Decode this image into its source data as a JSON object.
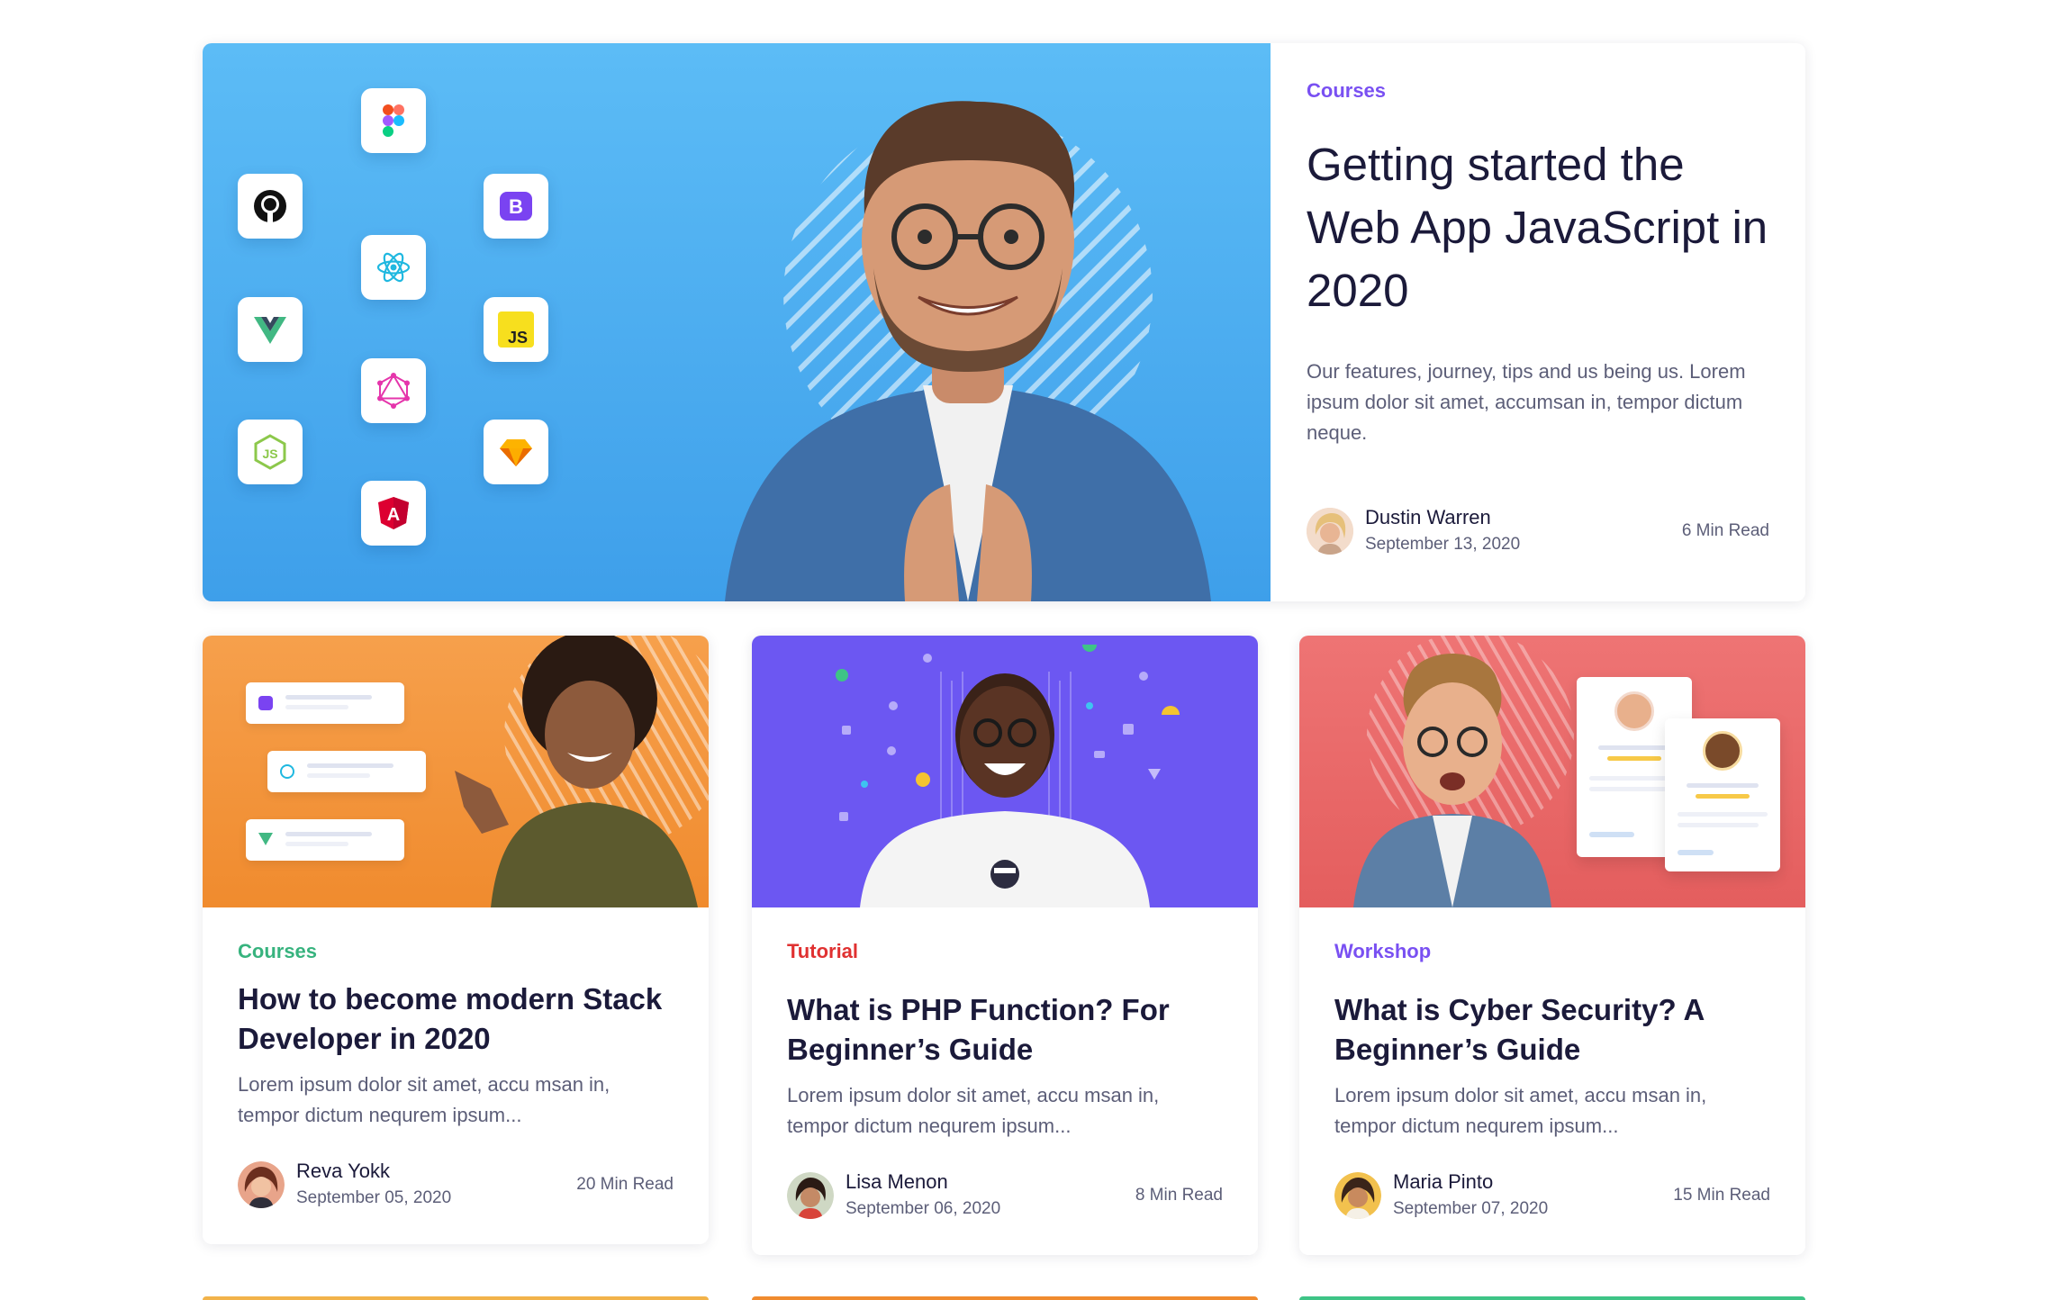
{
  "featured": {
    "tag": "Courses",
    "tag_color": "#7950f2",
    "title": "Getting started the Web App JavaScript in 2020",
    "description": "Our features, journey, tips and us being us. Lorem ipsum dolor sit amet, accumsan in, tempor dictum neque.",
    "author": "Dustin Warren",
    "date": "September 13, 2020",
    "read_time": "6 Min Read",
    "hero_icons": [
      "figma-icon",
      "github-icon",
      "bootstrap-icon",
      "react-icon",
      "vue-icon",
      "javascript-icon",
      "graphql-icon",
      "nodejs-icon",
      "sketch-icon",
      "angular-icon"
    ],
    "hero_icon_glyphs": {
      "bootstrap": "B",
      "javascript": "JS",
      "angular": "A"
    }
  },
  "cards": [
    {
      "tag": "Courses",
      "tag_color": "#37b37e",
      "title": "How to become modern Stack Developer in 2020",
      "description": "Lorem ipsum dolor sit amet, accu msan in, tempor dictum nequrem ipsum...",
      "author": "Reva Yokk",
      "date": "September 05, 2020",
      "read_time": "20 Min Read",
      "image_bg": "#f59a3e"
    },
    {
      "tag": "Tutorial",
      "tag_color": "#e03131",
      "title": "What is PHP Function? For Beginner’s Guide",
      "description": "Lorem ipsum dolor sit amet, accu msan in, tempor dictum nequrem ipsum...",
      "author": "Lisa Menon",
      "date": "September 06, 2020",
      "read_time": "8 Min Read",
      "image_bg": "#6c57f2"
    },
    {
      "tag": "Workshop",
      "tag_color": "#7950f2",
      "title": "What is Cyber Security? A Beginner’s Guide",
      "description": "Lorem ipsum dolor sit amet, accu msan in, tempor dictum nequrem ipsum...",
      "author": "Maria Pinto",
      "date": "September 07, 2020",
      "read_time": "15 Min Read",
      "image_bg": "#ea6a6a"
    }
  ]
}
